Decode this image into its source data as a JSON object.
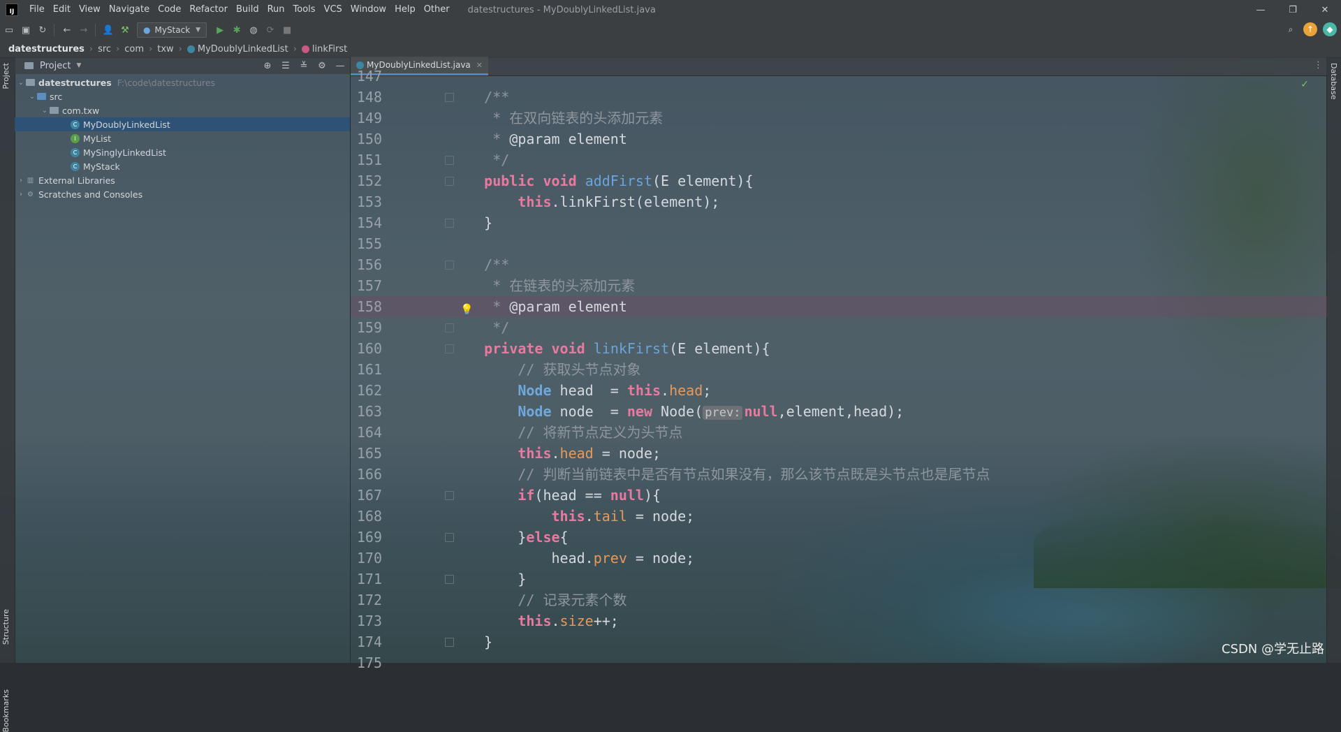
{
  "window": {
    "app_logo": "IJ",
    "title": "datestructures - MyDoublyLinkedList.java",
    "controls": [
      "—",
      "❐",
      "✕"
    ]
  },
  "menu": [
    "File",
    "Edit",
    "View",
    "Navigate",
    "Code",
    "Refactor",
    "Build",
    "Run",
    "Tools",
    "VCS",
    "Window",
    "Help",
    "Other"
  ],
  "toolbar": {
    "run_config": "MyStack"
  },
  "breadcrumb": {
    "project": "datestructures",
    "items": [
      "src",
      "com",
      "txw",
      "MyDoublyLinkedList",
      "linkFirst"
    ]
  },
  "left_stripe": {
    "project_tab": "Project",
    "structure_tab": "Structure",
    "bookmarks_tab": "Bookmarks"
  },
  "right_stripe": {
    "database_tab": "Database"
  },
  "project_panel": {
    "title": "Project",
    "root": {
      "name": "datestructures",
      "path": "F:\\code\\datestructures"
    },
    "src": "src",
    "package": "com.txw",
    "files": [
      {
        "name": "MyDoublyLinkedList",
        "kind": "class",
        "selected": true
      },
      {
        "name": "MyList",
        "kind": "interface",
        "selected": false
      },
      {
        "name": "MySinglyLinkedList",
        "kind": "class",
        "selected": false
      },
      {
        "name": "MyStack",
        "kind": "class",
        "selected": false
      }
    ],
    "external_libraries": "External Libraries",
    "scratches": "Scratches and Consoles"
  },
  "editor": {
    "tab": "MyDoublyLinkedList.java",
    "highlighted_line": 158,
    "lines": [
      {
        "n": "147",
        "tokens": []
      },
      {
        "n": "148",
        "indent": "    ",
        "tokens": [
          [
            "cm",
            "/**"
          ]
        ]
      },
      {
        "n": "149",
        "indent": "    ",
        "tokens": [
          [
            "cm",
            " * 在双向链表的头添加元素"
          ]
        ]
      },
      {
        "n": "150",
        "indent": "    ",
        "tokens": [
          [
            "cm",
            " * "
          ],
          [
            "txt",
            "@param"
          ],
          [
            "txt",
            " element"
          ]
        ]
      },
      {
        "n": "151",
        "indent": "    ",
        "tokens": [
          [
            "cm",
            " */"
          ]
        ]
      },
      {
        "n": "152",
        "indent": "    ",
        "tokens": [
          [
            "kw",
            "public"
          ],
          [
            "txt",
            " "
          ],
          [
            "kw",
            "void"
          ],
          [
            "txt",
            " "
          ],
          [
            "fn",
            "addFirst"
          ],
          [
            "txt",
            "(E element){"
          ]
        ]
      },
      {
        "n": "153",
        "indent": "        ",
        "tokens": [
          [
            "kw",
            "this"
          ],
          [
            "txt",
            ".linkFirst(element);"
          ]
        ]
      },
      {
        "n": "154",
        "indent": "    ",
        "tokens": [
          [
            "txt",
            "}"
          ]
        ]
      },
      {
        "n": "155",
        "tokens": []
      },
      {
        "n": "156",
        "indent": "    ",
        "tokens": [
          [
            "cm",
            "/**"
          ]
        ]
      },
      {
        "n": "157",
        "indent": "    ",
        "tokens": [
          [
            "cm",
            " * 在链表的头添加元素"
          ]
        ]
      },
      {
        "n": "158",
        "indent": "    ",
        "tokens": [
          [
            "cm",
            " * "
          ],
          [
            "txt",
            "@param"
          ],
          [
            "txt",
            " element"
          ]
        ]
      },
      {
        "n": "159",
        "indent": "    ",
        "tokens": [
          [
            "cm",
            " */"
          ]
        ]
      },
      {
        "n": "160",
        "indent": "    ",
        "tokens": [
          [
            "kw",
            "private"
          ],
          [
            "txt",
            " "
          ],
          [
            "kw",
            "void"
          ],
          [
            "txt",
            " "
          ],
          [
            "fn",
            "linkFirst"
          ],
          [
            "txt",
            "(E element){"
          ]
        ]
      },
      {
        "n": "161",
        "indent": "        ",
        "tokens": [
          [
            "cm",
            "// 获取头节点对象"
          ]
        ]
      },
      {
        "n": "162",
        "indent": "        ",
        "tokens": [
          [
            "tp",
            "Node"
          ],
          [
            "txt",
            " head  = "
          ],
          [
            "kw",
            "this"
          ],
          [
            "txt",
            "."
          ],
          [
            "fd",
            "head"
          ],
          [
            "txt",
            ";"
          ]
        ]
      },
      {
        "n": "163",
        "indent": "        ",
        "tokens": [
          [
            "tp",
            "Node"
          ],
          [
            "txt",
            " node  = "
          ],
          [
            "kw",
            "new"
          ],
          [
            "txt",
            " Node("
          ],
          [
            "hint",
            "prev:"
          ],
          [
            "kw",
            "null"
          ],
          [
            "txt",
            ",element,head);"
          ]
        ]
      },
      {
        "n": "164",
        "indent": "        ",
        "tokens": [
          [
            "cm",
            "// 将新节点定义为头节点"
          ]
        ]
      },
      {
        "n": "165",
        "indent": "        ",
        "tokens": [
          [
            "kw",
            "this"
          ],
          [
            "txt",
            "."
          ],
          [
            "fd",
            "head"
          ],
          [
            "txt",
            " = node;"
          ]
        ]
      },
      {
        "n": "166",
        "indent": "        ",
        "tokens": [
          [
            "cm",
            "// 判断当前链表中是否有节点如果没有，那么该节点既是头节点也是尾节点"
          ]
        ]
      },
      {
        "n": "167",
        "indent": "        ",
        "tokens": [
          [
            "kw",
            "if"
          ],
          [
            "txt",
            "(head == "
          ],
          [
            "kw",
            "null"
          ],
          [
            "txt",
            "){"
          ]
        ]
      },
      {
        "n": "168",
        "indent": "            ",
        "tokens": [
          [
            "kw",
            "this"
          ],
          [
            "txt",
            "."
          ],
          [
            "fd",
            "tail"
          ],
          [
            "txt",
            " = node;"
          ]
        ]
      },
      {
        "n": "169",
        "indent": "        ",
        "tokens": [
          [
            "txt",
            "}"
          ],
          [
            "kw",
            "else"
          ],
          [
            "txt",
            "{"
          ]
        ]
      },
      {
        "n": "170",
        "indent": "            ",
        "tokens": [
          [
            "txt",
            "head."
          ],
          [
            "fd",
            "prev"
          ],
          [
            "txt",
            " = node;"
          ]
        ]
      },
      {
        "n": "171",
        "indent": "        ",
        "tokens": [
          [
            "txt",
            "}"
          ]
        ]
      },
      {
        "n": "172",
        "indent": "        ",
        "tokens": [
          [
            "cm",
            "// 记录元素个数"
          ]
        ]
      },
      {
        "n": "173",
        "indent": "        ",
        "tokens": [
          [
            "kw",
            "this"
          ],
          [
            "txt",
            "."
          ],
          [
            "fd",
            "size"
          ],
          [
            "txt",
            "++;"
          ]
        ]
      },
      {
        "n": "174",
        "indent": "    ",
        "tokens": [
          [
            "txt",
            "}"
          ]
        ]
      },
      {
        "n": "175",
        "tokens": []
      }
    ]
  },
  "watermark": "CSDN @学无止路"
}
